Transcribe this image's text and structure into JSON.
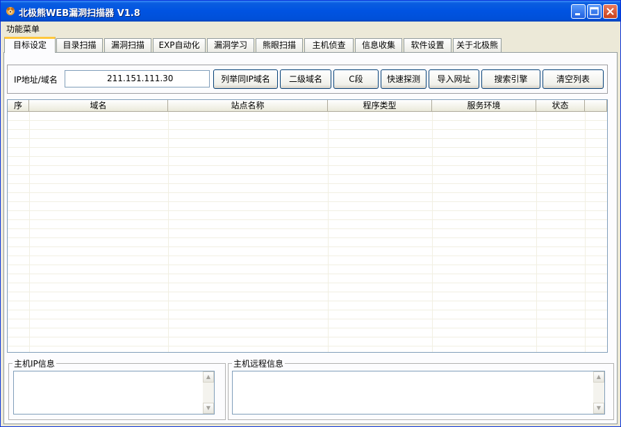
{
  "window": {
    "title": "北极熊WEB漏洞扫描器 V1.8",
    "accent": "#0054e3"
  },
  "menu": {
    "items": [
      "功能菜单"
    ]
  },
  "tabs": [
    {
      "label": "目标设定",
      "active": true
    },
    {
      "label": "目录扫描"
    },
    {
      "label": "漏洞扫描"
    },
    {
      "label": "EXP自动化"
    },
    {
      "label": "漏洞学习"
    },
    {
      "label": "熊眼扫描"
    },
    {
      "label": "主机侦查"
    },
    {
      "label": "信息收集"
    },
    {
      "label": "软件设置"
    },
    {
      "label": "关于北极熊"
    }
  ],
  "target": {
    "ip_label": "IP地址/域名",
    "ip_value": "211.151.111.30",
    "buttons": [
      "列举同IP域名",
      "二级域名",
      "C段",
      "快速探测",
      "导入网址",
      "搜索引擎",
      "清空列表"
    ]
  },
  "grid": {
    "columns": [
      "序",
      "域名",
      "站点名称",
      "程序类型",
      "服务环境",
      "状态"
    ],
    "rows": []
  },
  "panels": {
    "host_ip_label": "主机IP信息",
    "host_remote_label": "主机远程信息"
  }
}
